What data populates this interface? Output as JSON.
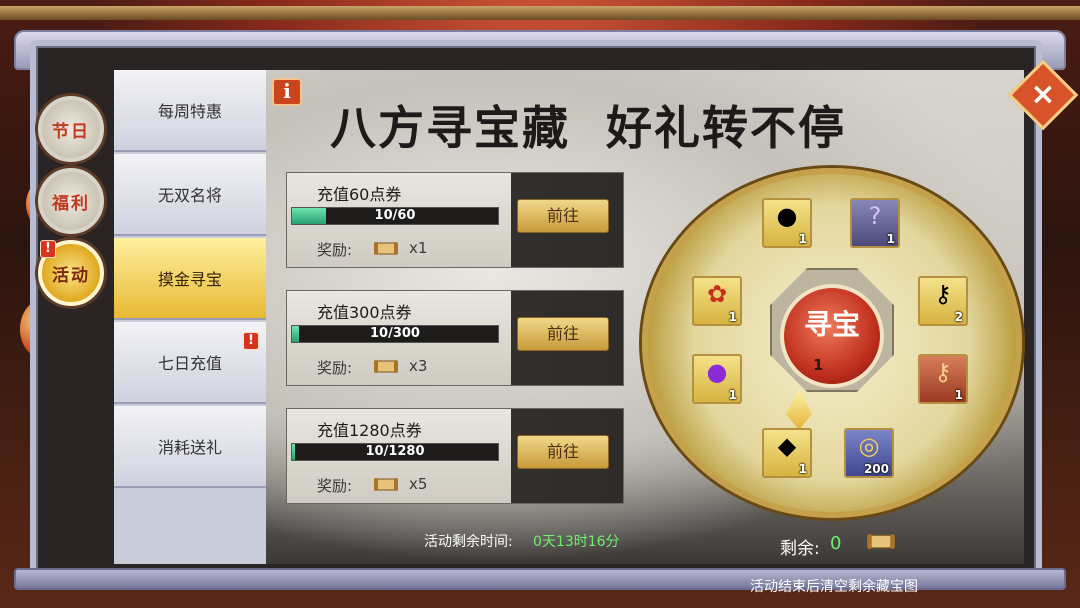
{
  "side_tabs": [
    {
      "label": "节日"
    },
    {
      "label": "福利"
    },
    {
      "label": "活动",
      "alert": "!"
    }
  ],
  "menu": [
    {
      "label": "每周特惠"
    },
    {
      "label": "无双名将"
    },
    {
      "label": "摸金寻宝",
      "selected": true
    },
    {
      "label": "七日充值",
      "alert": "!"
    },
    {
      "label": "消耗送礼"
    }
  ],
  "info_icon": "i",
  "banner_title": "八方寻宝藏  好礼转不停",
  "tasks": [
    {
      "name": "充值60点券",
      "progress_text": "10/60",
      "progress": 0.167,
      "reward_label": "奖励:",
      "reward_count": "x1",
      "button": "前往"
    },
    {
      "name": "充值300点券",
      "progress_text": "10/300",
      "progress": 0.033,
      "reward_label": "奖励:",
      "reward_count": "x3",
      "button": "前往"
    },
    {
      "name": "充值1280点券",
      "progress_text": "10/1280",
      "progress": 0.008,
      "reward_label": "奖励:",
      "reward_count": "x5",
      "button": "前往"
    }
  ],
  "countdown": {
    "label": "活动剩余时间:",
    "value": "0天13时16分"
  },
  "wheel": {
    "center_label": "寻宝",
    "center_cost": "1",
    "slots": [
      {
        "icon": "red-orb-icon",
        "qty": "1"
      },
      {
        "icon": "mystery-beast-icon",
        "qty": "1"
      },
      {
        "icon": "golden-key-icon",
        "qty": "2"
      },
      {
        "icon": "bronze-key-icon",
        "qty": "1"
      },
      {
        "icon": "coin-pile-icon",
        "qty": "200"
      },
      {
        "icon": "gold-ingot-icon",
        "qty": "1"
      },
      {
        "icon": "purple-gem-icon",
        "qty": "1"
      },
      {
        "icon": "dragon-amulet-icon",
        "qty": "1"
      }
    ]
  },
  "remaining": {
    "label": "剩余:",
    "value": "0"
  },
  "footer_note": "活动结束后清空剩余藏宝图",
  "close_icon": "×",
  "colors": {
    "accent_green": "#6ef06e",
    "button_gold": "#c99a3a",
    "alert_red": "#d8331f"
  }
}
